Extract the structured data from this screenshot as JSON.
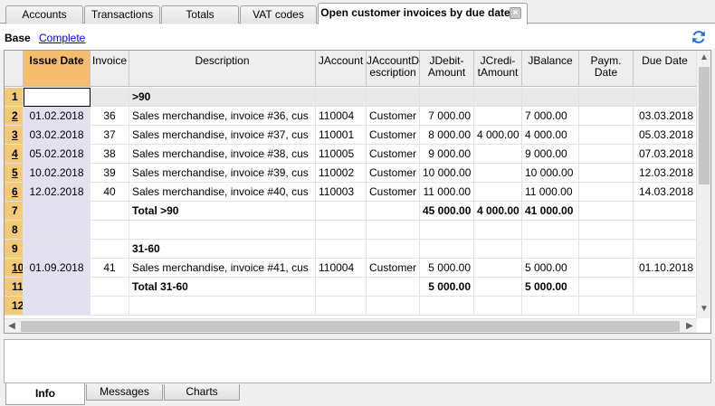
{
  "tabs": [
    {
      "label": "Accounts"
    },
    {
      "label": "Transactions"
    },
    {
      "label": "Totals"
    },
    {
      "label": "VAT codes"
    },
    {
      "label": "Open customer invoices by due date"
    }
  ],
  "close_symbol": "×",
  "view": {
    "base": "Base",
    "complete": "Complete"
  },
  "columns": [
    "Issue Date",
    "Invoice",
    "Description",
    "JAccount",
    "JAccountD-escription",
    "JDebit-Amount",
    "JCredi-tAmount",
    "JBalance",
    "Paym. Date",
    "Due Date"
  ],
  "rows": [
    {
      "n": "1",
      "issue": "",
      "inv": "",
      "desc": ">90",
      "acc": "",
      "accd": "",
      "debit": "",
      "credit": "",
      "bal": "",
      "paym": "",
      "due": "",
      "bold": true,
      "group": true
    },
    {
      "n": "2",
      "issue": "01.02.2018",
      "inv": "36",
      "desc": "Sales merchandise, invoice #36, cus",
      "acc": "110004",
      "accd": "Customer",
      "debit": "7 000.00",
      "credit": "",
      "bal": "7 000.00",
      "paym": "",
      "due": "03.03.2018"
    },
    {
      "n": "3",
      "issue": "03.02.2018",
      "inv": "37",
      "desc": "Sales merchandise, invoice #37, cus",
      "acc": "110001",
      "accd": "Customer",
      "debit": "8 000.00",
      "credit": "4 000.00",
      "bal": "4 000.00",
      "paym": "",
      "due": "05.03.2018"
    },
    {
      "n": "4",
      "issue": "05.02.2018",
      "inv": "38",
      "desc": "Sales merchandise, invoice #38, cus",
      "acc": "110005",
      "accd": "Customer",
      "debit": "9 000.00",
      "credit": "",
      "bal": "9 000.00",
      "paym": "",
      "due": "07.03.2018"
    },
    {
      "n": "5",
      "issue": "10.02.2018",
      "inv": "39",
      "desc": "Sales merchandise, invoice #39, cus",
      "acc": "110002",
      "accd": "Customer",
      "debit": "10 000.00",
      "credit": "",
      "bal": "10 000.00",
      "paym": "",
      "due": "12.03.2018"
    },
    {
      "n": "6",
      "issue": "12.02.2018",
      "inv": "40",
      "desc": "Sales merchandise, invoice #40, cus",
      "acc": "110003",
      "accd": "Customer",
      "debit": "11 000.00",
      "credit": "",
      "bal": "11 000.00",
      "paym": "",
      "due": "14.03.2018"
    },
    {
      "n": "7",
      "issue": "",
      "inv": "",
      "desc": "Total >90",
      "acc": "",
      "accd": "",
      "debit": "45 000.00",
      "credit": "4 000.00",
      "bal": "41 000.00",
      "paym": "",
      "due": "",
      "bold": true
    },
    {
      "n": "8",
      "issue": "",
      "inv": "",
      "desc": "",
      "acc": "",
      "accd": "",
      "debit": "",
      "credit": "",
      "bal": "",
      "paym": "",
      "due": ""
    },
    {
      "n": "9",
      "issue": "",
      "inv": "",
      "desc": "31-60",
      "acc": "",
      "accd": "",
      "debit": "",
      "credit": "",
      "bal": "",
      "paym": "",
      "due": "",
      "bold": true
    },
    {
      "n": "10",
      "issue": "01.09.2018",
      "inv": "41",
      "desc": "Sales merchandise, invoice #41, cus",
      "acc": "110004",
      "accd": "Customer",
      "debit": "5 000.00",
      "credit": "",
      "bal": "5 000.00",
      "paym": "",
      "due": "01.10.2018"
    },
    {
      "n": "11",
      "issue": "",
      "inv": "",
      "desc": "Total 31-60",
      "acc": "",
      "accd": "",
      "debit": "5 000.00",
      "credit": "",
      "bal": "5 000.00",
      "paym": "",
      "due": "",
      "bold": true
    },
    {
      "n": "12",
      "issue": "",
      "inv": "",
      "desc": "",
      "acc": "",
      "accd": "",
      "debit": "",
      "credit": "",
      "bal": "",
      "paym": "",
      "due": ""
    }
  ],
  "bottom_tabs": [
    {
      "label": "Info"
    },
    {
      "label": "Messages"
    },
    {
      "label": "Charts"
    }
  ],
  "icons": {
    "refresh": "refresh-icon",
    "close": "close-icon"
  },
  "colors": {
    "selected_header": "#f5bd6e",
    "row_number": "#f5c97a",
    "issue_col": "#e3e0ef",
    "accent": "#1e73d2"
  }
}
